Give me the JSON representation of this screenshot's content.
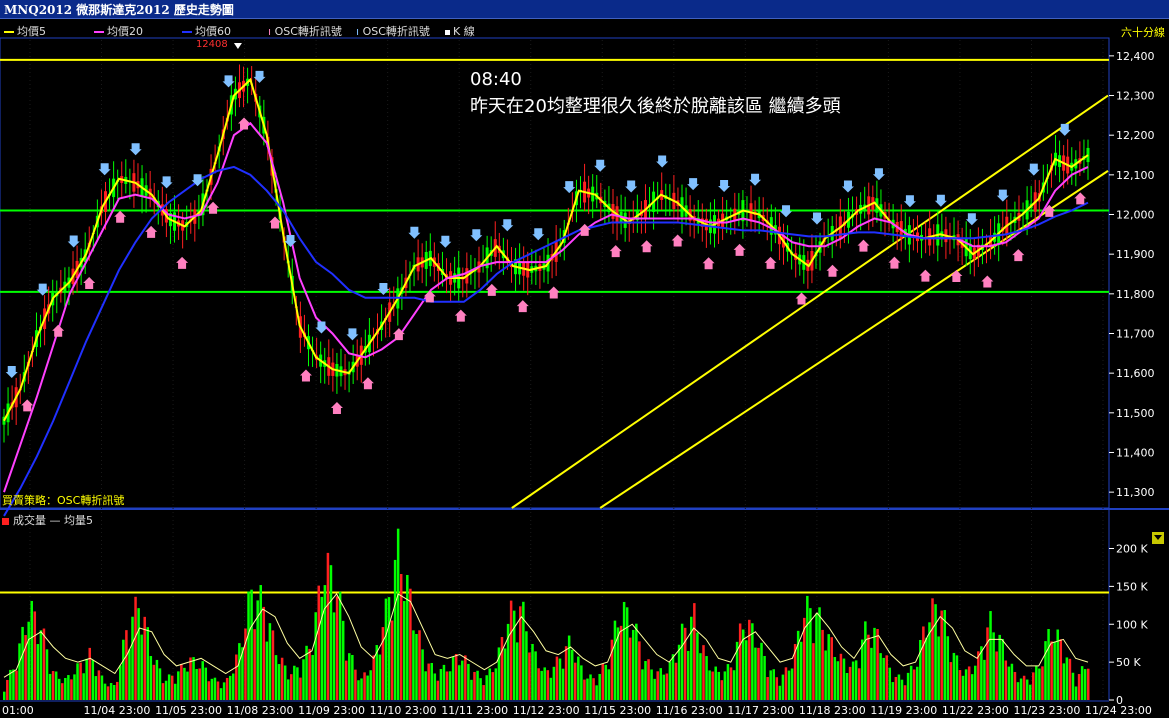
{
  "window": {
    "title": "MNQ2012 微那斯達克2012  歷史走勢圖"
  },
  "legend": [
    {
      "label": "均價5",
      "color": "#ffff00",
      "kind": "line"
    },
    {
      "label": "均價20",
      "color": "#ff40ff",
      "kind": "line"
    },
    {
      "label": "均價60",
      "color": "#2030ff",
      "kind": "line"
    },
    {
      "label": "OSC轉折訊號",
      "color": "#ff80c0",
      "kind": "tick"
    },
    {
      "label": "OSC轉折訊號",
      "color": "#80c0ff",
      "kind": "tick"
    },
    {
      "label": "K 線",
      "color": "#ffffff",
      "kind": "dot"
    }
  ],
  "panel_label": "六十分線",
  "annotation": {
    "time": "08:40",
    "text": "昨天在20均整理很久後終於脫離該區 繼續多頭"
  },
  "strategy_label": "買賣策略：OSC轉折訊號",
  "volume_legend": {
    "series1": "成交量",
    "separator": "—",
    "series2": "均量5"
  },
  "chart_data": [
    {
      "type": "line",
      "name": "price",
      "ylim": [
        11260,
        12440
      ],
      "yticks": [
        "12,400",
        "12,300",
        "12,200",
        "12,100",
        "12,000",
        "11,900",
        "11,800",
        "11,700",
        "11,600",
        "11,500",
        "11,400",
        "11,300"
      ],
      "ytick_values": [
        12400,
        12300,
        12200,
        12100,
        12000,
        11900,
        11800,
        11700,
        11600,
        11500,
        11400,
        11300
      ],
      "xticks": [
        "01:00",
        "11/04 23:00",
        "11/05 23:00",
        "11/08 23:00",
        "11/09 23:00",
        "11/10 23:00",
        "11/11 23:00",
        "11/12 23:00",
        "11/15 23:00",
        "11/16 23:00",
        "11/17 23:00",
        "11/18 23:00",
        "11/19 23:00",
        "11/22 23:00",
        "11/23 23:00",
        "11/24 23:00"
      ],
      "high_label": "12408",
      "horizontal_lines": [
        12390,
        12010,
        11805
      ],
      "series": [
        {
          "key": "ma5",
          "color": "#ffff00",
          "values": [
            11480,
            11560,
            11690,
            11790,
            11830,
            11900,
            12020,
            12090,
            12080,
            12050,
            11990,
            11970,
            12010,
            12150,
            12300,
            12340,
            12200,
            11950,
            11720,
            11640,
            11610,
            11600,
            11660,
            11720,
            11790,
            11870,
            11890,
            11840,
            11840,
            11870,
            11920,
            11870,
            11860,
            11870,
            11930,
            12060,
            12050,
            12010,
            11980,
            12010,
            12050,
            12030,
            11990,
            11970,
            11990,
            12010,
            12000,
            11960,
            11900,
            11870,
            11940,
            11970,
            12010,
            12030,
            11980,
            11950,
            11940,
            11950,
            11940,
            11900,
            11930,
            11970,
            12000,
            12040,
            12140,
            12120,
            12150
          ]
        },
        {
          "key": "ma20",
          "color": "#ff40ff",
          "values": [
            11300,
            11420,
            11540,
            11670,
            11800,
            11880,
            11960,
            12040,
            12050,
            12040,
            12000,
            11990,
            12000,
            12080,
            12200,
            12230,
            12180,
            12030,
            11840,
            11740,
            11700,
            11650,
            11640,
            11660,
            11690,
            11750,
            11810,
            11840,
            11850,
            11870,
            11880,
            11880,
            11880,
            11880,
            11910,
            11950,
            11980,
            12000,
            11990,
            11990,
            11990,
            11990,
            11990,
            11980,
            11980,
            11990,
            11980,
            11960,
            11930,
            11920,
            11920,
            11940,
            11970,
            11990,
            11980,
            11950,
            11940,
            11940,
            11940,
            11920,
            11920,
            11930,
            11960,
            11990,
            12060,
            12100,
            12120
          ]
        },
        {
          "key": "ma60",
          "color": "#2030ff",
          "values": [
            11240,
            11310,
            11390,
            11480,
            11580,
            11680,
            11770,
            11860,
            11930,
            11990,
            12030,
            12060,
            12090,
            12110,
            12120,
            12100,
            12060,
            12010,
            11940,
            11880,
            11850,
            11810,
            11790,
            11790,
            11790,
            11790,
            11780,
            11780,
            11780,
            11810,
            11850,
            11880,
            11900,
            11920,
            11940,
            11960,
            11970,
            11980,
            11980,
            11980,
            11980,
            11980,
            11975,
            11970,
            11965,
            11960,
            11960,
            11955,
            11950,
            11945,
            11945,
            11950,
            11955,
            11955,
            11950,
            11945,
            11940,
            11940,
            11940,
            11940,
            11945,
            11950,
            11960,
            11975,
            11995,
            12010,
            12030
          ]
        }
      ],
      "trend_lines": [
        {
          "from": [
            0.46,
            11260
          ],
          "to": [
            1.0,
            12300
          ]
        },
        {
          "from": [
            0.54,
            11260
          ],
          "to": [
            1.0,
            12110
          ]
        }
      ]
    },
    {
      "type": "bar",
      "name": "volume",
      "ylim": [
        0,
        235
      ],
      "yticks": [
        "200 K",
        "150 K",
        "100 K",
        "50 K",
        "0"
      ],
      "ytick_values": [
        200,
        150,
        100,
        50,
        0
      ],
      "horizontal_line": 142,
      "values": [
        20,
        60,
        140,
        110,
        40,
        30,
        50,
        70,
        30,
        20,
        110,
        150,
        70,
        30,
        40,
        60,
        55,
        30,
        25,
        70,
        160,
        150,
        80,
        40,
        50,
        90,
        210,
        170,
        70,
        30,
        60,
        135,
        230,
        150,
        70,
        40,
        50,
        70,
        45,
        30,
        60,
        130,
        140,
        70,
        40,
        60,
        90,
        40,
        30,
        60,
        140,
        120,
        60,
        40,
        50,
        100,
        130,
        60,
        40,
        50,
        120,
        100,
        50,
        30,
        60,
        140,
        130,
        90,
        60,
        50,
        110,
        95,
        40,
        30,
        55,
        130,
        145,
        70,
        40,
        60,
        120,
        85,
        40,
        30,
        50,
        110,
        80,
        30,
        60
      ],
      "colors_pattern": [
        "#00ff00",
        "#ff2020"
      ],
      "ma_values": [
        30,
        40,
        80,
        90,
        70,
        55,
        50,
        55,
        45,
        35,
        60,
        95,
        90,
        60,
        45,
        50,
        55,
        45,
        35,
        45,
        95,
        120,
        110,
        75,
        55,
        65,
        120,
        140,
        110,
        70,
        55,
        85,
        140,
        130,
        95,
        60,
        55,
        60,
        50,
        40,
        50,
        85,
        110,
        90,
        65,
        60,
        70,
        55,
        45,
        50,
        90,
        100,
        80,
        60,
        50,
        70,
        95,
        80,
        55,
        50,
        80,
        90,
        70,
        50,
        55,
        95,
        115,
        95,
        70,
        55,
        80,
        85,
        60,
        45,
        50,
        85,
        110,
        95,
        65,
        55,
        80,
        80,
        60,
        45,
        45,
        75,
        80,
        55,
        50
      ]
    }
  ]
}
